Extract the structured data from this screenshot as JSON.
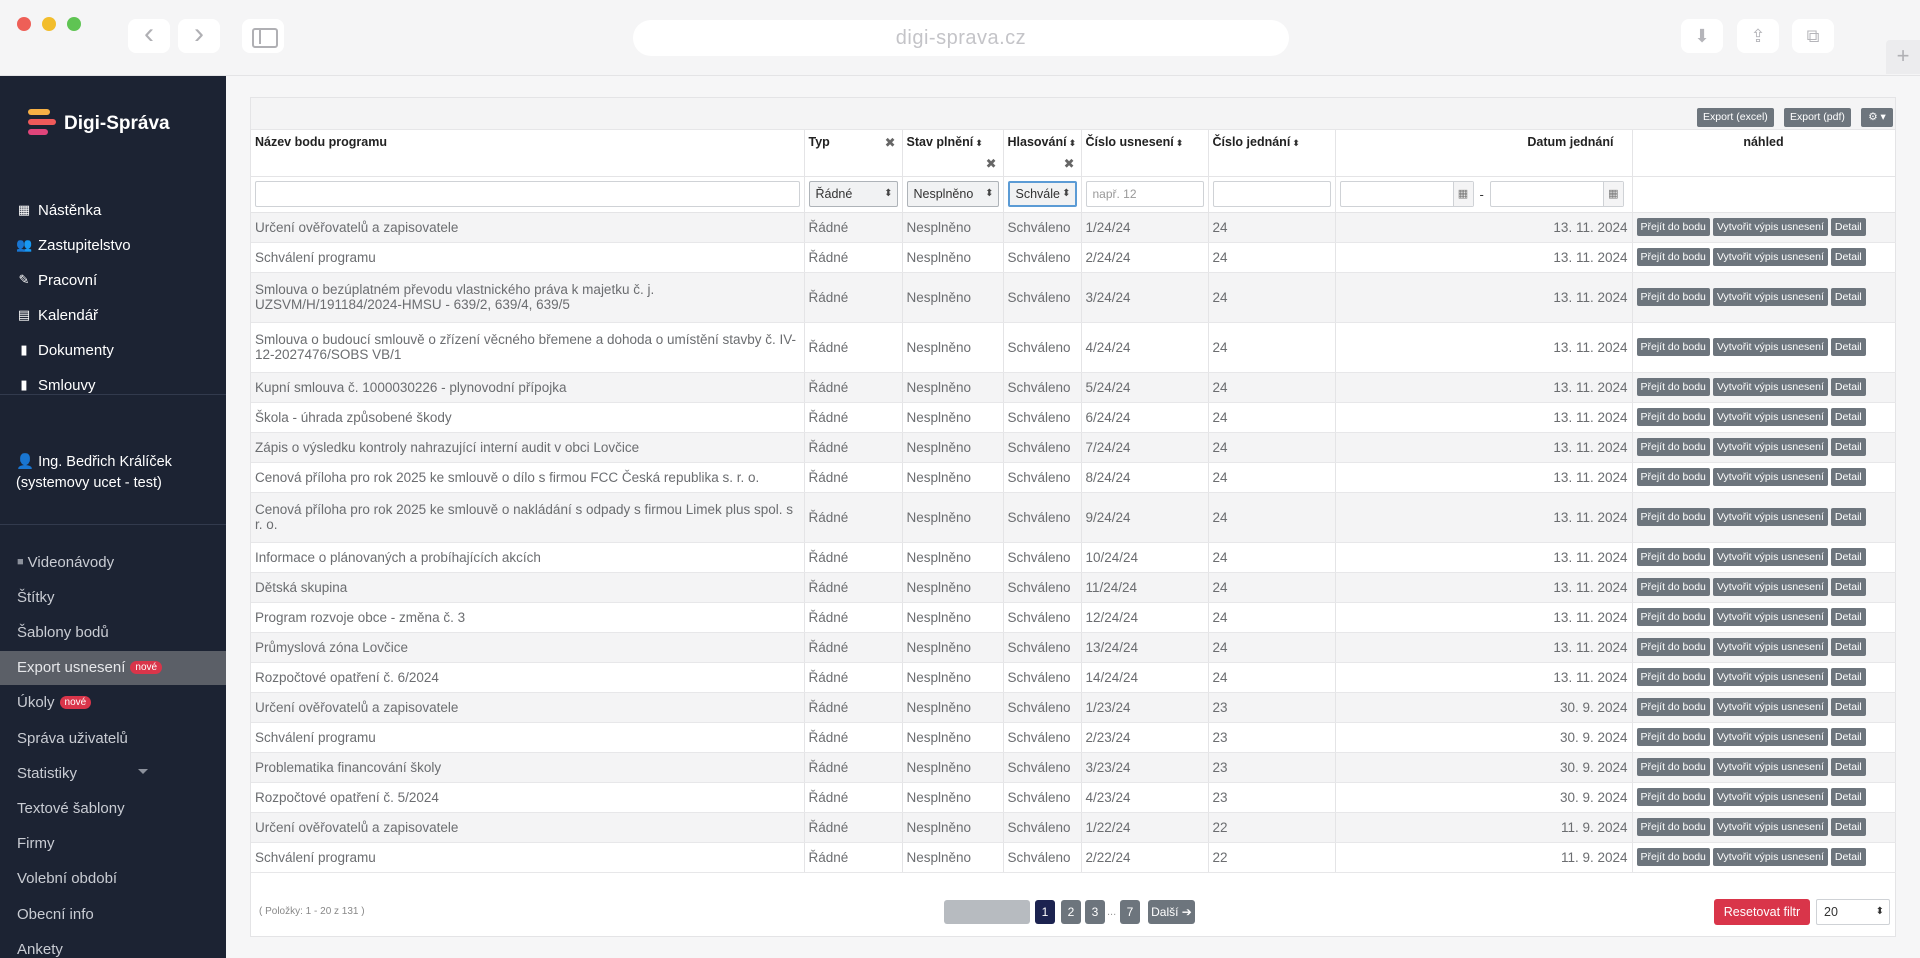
{
  "browser": {
    "url": "digi-sprava.cz",
    "back_glyph": "‹",
    "forward_glyph": "›",
    "download_glyph": "⬇",
    "share_glyph": "⇪",
    "tabs_glyph": "⧉",
    "newtab_glyph": "+"
  },
  "app": {
    "name": "Digi-Správa"
  },
  "sidebar": {
    "menu": [
      {
        "label": "Nástěnka",
        "icon": "▦",
        "icon_name": "dashboard-icon"
      },
      {
        "label": "Zastupitelstvo",
        "icon": "👥",
        "icon_name": "users-icon"
      },
      {
        "label": "Pracovní",
        "icon": "✎",
        "icon_name": "user-edit-icon"
      },
      {
        "label": "Kalendář",
        "icon": "▤",
        "icon_name": "calendar-icon"
      },
      {
        "label": "Dokumenty",
        "icon": "▮",
        "icon_name": "document-icon"
      },
      {
        "label": "Smlouvy",
        "icon": "▮",
        "icon_name": "contract-icon"
      }
    ],
    "user": {
      "icon": "👤",
      "name": "Ing. Bedřich Králíček",
      "role": "(systemovy ucet - test)"
    },
    "menu2": [
      {
        "label": "Videonávody",
        "icon": "■"
      },
      {
        "label": "Štítky"
      },
      {
        "label": "Šablony bodů"
      },
      {
        "label": "Export usnesení",
        "badge": "nové",
        "active": true
      },
      {
        "label": "Úkoly",
        "badge": "nové"
      },
      {
        "label": "Správa uživatelů"
      },
      {
        "label": "Statistiky",
        "has_chevron": true
      },
      {
        "label": "Textové šablony"
      },
      {
        "label": "Firmy"
      },
      {
        "label": "Volební období"
      },
      {
        "label": "Obecní info"
      },
      {
        "label": "Ankety"
      }
    ]
  },
  "toolbar": {
    "export_excel": "Export (excel)",
    "export_pdf": "Export (pdf)",
    "settings_glyph": "⚙ ▾"
  },
  "table": {
    "headers": {
      "name": "Název bodu programu",
      "type": "Typ",
      "state": "Stav plnění",
      "vote": "Hlasování",
      "resolution": "Číslo usnesení",
      "meeting_no": "Číslo jednání",
      "date": "Datum jednání",
      "preview": "náhled"
    },
    "sort_glyph": "⬍",
    "clear_glyph": "✖",
    "filters": {
      "type": "Řádné",
      "state": "Nesplněno",
      "vote": "Schvále",
      "resolution_placeholder": "např. 12",
      "date_separator": "-",
      "cal_glyph": "▦"
    },
    "action_labels": {
      "goto": "Přejít do bodu",
      "extract": "Vytvořit výpis usnesení",
      "detail": "Detail"
    },
    "rows": [
      {
        "name": "Určení ověřovatelů a zapisovatele",
        "type": "Řádné",
        "state": "Nesplněno",
        "vote": "Schváleno",
        "resolution": "1/24/24",
        "meeting": "24",
        "date": "13. 11. 2024"
      },
      {
        "name": "Schválení programu",
        "type": "Řádné",
        "state": "Nesplněno",
        "vote": "Schváleno",
        "resolution": "2/24/24",
        "meeting": "24",
        "date": "13. 11. 2024"
      },
      {
        "name": "Smlouva o bezúplatném převodu vlastnického práva k majetku č. j. UZSVM/H/191184/2024-HMSU - 639/2, 639/4, 639/5",
        "type": "Řádné",
        "state": "Nesplněno",
        "vote": "Schváleno",
        "resolution": "3/24/24",
        "meeting": "24",
        "date": "13. 11. 2024"
      },
      {
        "name": "Smlouva o budoucí smlouvě o zřízení věcného břemene a dohoda o umístění stavby č. IV-12-2027476/SOBS VB/1",
        "type": "Řádné",
        "state": "Nesplněno",
        "vote": "Schváleno",
        "resolution": "4/24/24",
        "meeting": "24",
        "date": "13. 11. 2024"
      },
      {
        "name": "Kupní smlouva č. 1000030226 - plynovodní přípojka",
        "type": "Řádné",
        "state": "Nesplněno",
        "vote": "Schváleno",
        "resolution": "5/24/24",
        "meeting": "24",
        "date": "13. 11. 2024"
      },
      {
        "name": "Škola - úhrada způsobené škody",
        "type": "Řádné",
        "state": "Nesplněno",
        "vote": "Schváleno",
        "resolution": "6/24/24",
        "meeting": "24",
        "date": "13. 11. 2024"
      },
      {
        "name": "Zápis o výsledku kontroly nahrazující interní audit v obci Lovčice",
        "type": "Řádné",
        "state": "Nesplněno",
        "vote": "Schváleno",
        "resolution": "7/24/24",
        "meeting": "24",
        "date": "13. 11. 2024"
      },
      {
        "name": "Cenová příloha pro rok 2025 ke smlouvě o dílo s firmou FCC Česká republika s. r. o.",
        "type": "Řádné",
        "state": "Nesplněno",
        "vote": "Schváleno",
        "resolution": "8/24/24",
        "meeting": "24",
        "date": "13. 11. 2024"
      },
      {
        "name": "Cenová příloha pro rok 2025 ke smlouvě o nakládání s odpady s firmou Limek plus spol. s r. o.",
        "type": "Řádné",
        "state": "Nesplněno",
        "vote": "Schváleno",
        "resolution": "9/24/24",
        "meeting": "24",
        "date": "13. 11. 2024"
      },
      {
        "name": "Informace o plánovaných a probíhajících akcích",
        "type": "Řádné",
        "state": "Nesplněno",
        "vote": "Schváleno",
        "resolution": "10/24/24",
        "meeting": "24",
        "date": "13. 11. 2024"
      },
      {
        "name": "Dětská skupina",
        "type": "Řádné",
        "state": "Nesplněno",
        "vote": "Schváleno",
        "resolution": "11/24/24",
        "meeting": "24",
        "date": "13. 11. 2024"
      },
      {
        "name": "Program rozvoje obce - změna č. 3",
        "type": "Řádné",
        "state": "Nesplněno",
        "vote": "Schváleno",
        "resolution": "12/24/24",
        "meeting": "24",
        "date": "13. 11. 2024"
      },
      {
        "name": "Průmyslová zóna Lovčice",
        "type": "Řádné",
        "state": "Nesplněno",
        "vote": "Schváleno",
        "resolution": "13/24/24",
        "meeting": "24",
        "date": "13. 11. 2024"
      },
      {
        "name": "Rozpočtové opatření č. 6/2024",
        "type": "Řádné",
        "state": "Nesplněno",
        "vote": "Schváleno",
        "resolution": "14/24/24",
        "meeting": "24",
        "date": "13. 11. 2024"
      },
      {
        "name": "Určení ověřovatelů a zapisovatele",
        "type": "Řádné",
        "state": "Nesplněno",
        "vote": "Schváleno",
        "resolution": "1/23/24",
        "meeting": "23",
        "date": "30. 9. 2024"
      },
      {
        "name": "Schválení programu",
        "type": "Řádné",
        "state": "Nesplněno",
        "vote": "Schváleno",
        "resolution": "2/23/24",
        "meeting": "23",
        "date": "30. 9. 2024"
      },
      {
        "name": "Problematika financování školy",
        "type": "Řádné",
        "state": "Nesplněno",
        "vote": "Schváleno",
        "resolution": "3/23/24",
        "meeting": "23",
        "date": "30. 9. 2024"
      },
      {
        "name": "Rozpočtové opatření č. 5/2024",
        "type": "Řádné",
        "state": "Nesplněno",
        "vote": "Schváleno",
        "resolution": "4/23/24",
        "meeting": "23",
        "date": "30. 9. 2024"
      },
      {
        "name": "Určení ověřovatelů a zapisovatele",
        "type": "Řádné",
        "state": "Nesplněno",
        "vote": "Schváleno",
        "resolution": "1/22/24",
        "meeting": "22",
        "date": "11. 9. 2024"
      },
      {
        "name": "Schválení programu",
        "type": "Řádné",
        "state": "Nesplněno",
        "vote": "Schváleno",
        "resolution": "2/22/24",
        "meeting": "22",
        "date": "11. 9. 2024"
      }
    ]
  },
  "footer": {
    "items_info": "( Položky: 1 - 20 z 131 )",
    "pages": [
      "1",
      "2",
      "3",
      "7"
    ],
    "current_page": "1",
    "dots": "...",
    "next_label": "Další ➔",
    "reset_label": "Resetovat filtr",
    "page_size": "20"
  }
}
